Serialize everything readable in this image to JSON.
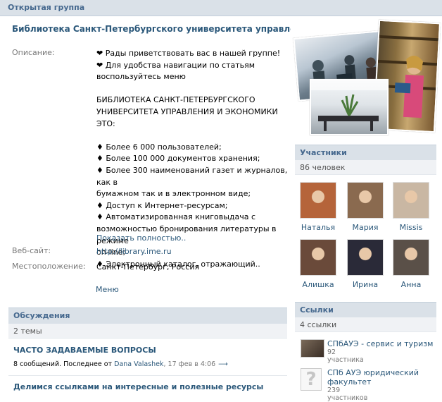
{
  "header": {
    "title": "Открытая группа"
  },
  "group": {
    "name": "Библиотека Санкт-Петербургского университета управления и экономики"
  },
  "info": {
    "description_label": "Описание:",
    "description_lines": [
      "❤ Рады приветствовать вас в нашей группе!",
      "❤ Для удобства навигации по статьям",
      "воспользуйтесь меню",
      "",
      "БИБЛИОТЕКА САНКТ-ПЕТЕРБУРГСКОГО",
      "УНИВЕРСИТЕТА УПРАВЛЕНИЯ И ЭКОНОМИКИ ЭТО:",
      "",
      "♦ Более 6 000 пользователей;",
      "♦ Более 100 000 документов хранения;",
      "♦ Более 300 наименований газет и журналов, как в",
      "бумажном так и в электронном виде;",
      "♦ Доступ к Интернет-ресурсам;",
      "♦ Автоматизированная книговыдача с",
      "возможностью бронирования литературы в режиме",
      "on-line;",
      "♦ Электронный каталог, отражающий.."
    ],
    "show_more": "Показать полностью..",
    "website_label": "Веб-сайт:",
    "website": "http://library.ime.ru",
    "location_label": "Местоположение:",
    "location": "Санкт-Петербург, Россия",
    "menu": "Меню"
  },
  "discussions": {
    "title": "Обсуждения",
    "count": "2 темы",
    "topics": [
      {
        "title": "ЧАСТО ЗАДАВАЕМЫЕ ВОПРОСЫ",
        "meta": "8 сообщений. Последнее от ",
        "author": "Dana Valashek",
        "date": ", 17 фев в 4:06",
        "arrow": "⟶"
      },
      {
        "title": "Делимся ссылками на интересные и полезные ресурсы"
      }
    ]
  },
  "members": {
    "title": "Участники",
    "count": "86 человек",
    "list": [
      {
        "name": "Наталья",
        "color": "#b5643a"
      },
      {
        "name": "Мария",
        "color": "#8a6a4f"
      },
      {
        "name": "Missis",
        "color": "#c9b7a3"
      },
      {
        "name": "Алишка",
        "color": "#6a4a3a"
      },
      {
        "name": "Ирина",
        "color": "#2a2a38"
      },
      {
        "name": "Анна",
        "color": "#5a5048"
      }
    ]
  },
  "links": {
    "title": "Ссылки",
    "count": "4 ссылки",
    "items": [
      {
        "title": "СПбАУЭ - сервис и туризм",
        "sub": "92 участника"
      },
      {
        "title": "СПб АУЭ юридический факультет",
        "sub": "239 участников"
      }
    ]
  }
}
